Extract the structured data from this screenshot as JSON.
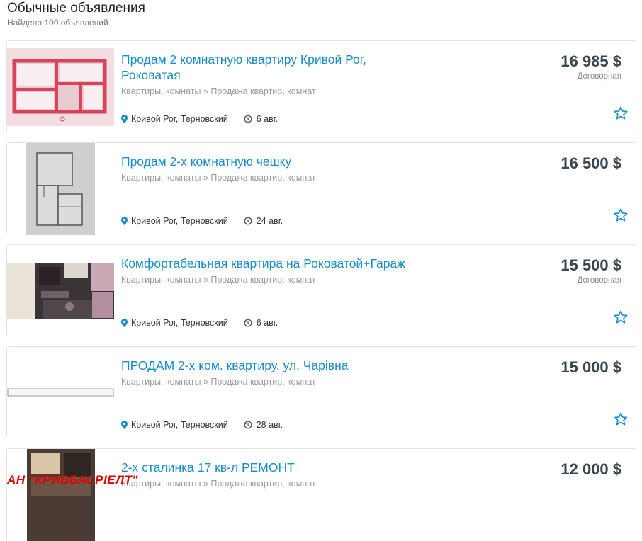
{
  "header": {
    "title": "Обычные объявления",
    "subtitle": "Найдено 100 объявлений"
  },
  "listings": [
    {
      "title": "Продам 2 комнатную квартиру Кривой Рог, Роковатая",
      "category": "Квартиры, комнаты » Продажа квартир, комнат",
      "location": "Кривой Рог, Терновский",
      "date": "6 авг.",
      "price": "16 985 $",
      "negotiable": "Договорная"
    },
    {
      "title": "Продам 2-х комнатную чешку",
      "category": "Квартиры, комнаты » Продажа квартир, комнат",
      "location": "Кривой Рог, Терновский",
      "date": "24 авг.",
      "price": "16 500 $",
      "negotiable": ""
    },
    {
      "title": "Комфортабельная квартира на Роковатой+Гараж",
      "category": "Квартиры, комнаты » Продажа квартир, комнат",
      "location": "Кривой Рог, Терновский",
      "date": "6 авг.",
      "price": "15 500 $",
      "negotiable": "Договорная"
    },
    {
      "title": "ПРОДАМ 2-х ком. квартиру. ул. Чарівна",
      "category": "Квартиры, комнаты » Продажа квартир, комнат",
      "location": "Кривой Рог, Терновский",
      "date": "28 авг.",
      "price": "15 000 $",
      "negotiable": ""
    },
    {
      "title": "2-х сталинка 17 кв-л РЕМОНТ",
      "category": "Квартиры, комнаты » Продажа квартир, комнат",
      "location": "",
      "date": "",
      "price": "12 000 $",
      "negotiable": ""
    }
  ],
  "watermark": "АН \"КРИВБАСРІЕЛТ\"",
  "icons": {
    "location": "map-pin-icon",
    "date": "history-clock-icon",
    "favorite": "star-outline-icon"
  },
  "colors": {
    "link": "#1a8cc9",
    "price": "#3b4750",
    "muted": "#9a9a9a",
    "accent": "#1a8cc9",
    "watermark": "#e00000"
  }
}
